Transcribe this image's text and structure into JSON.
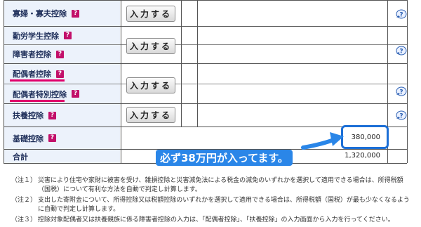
{
  "rows": [
    {
      "label": "寡婦・寡夫控除",
      "button": "入力する"
    },
    {
      "label": "勤労学生控除",
      "button": "入力する"
    },
    {
      "label": "障害者控除"
    },
    {
      "label": "配偶者控除",
      "button": "入力する"
    },
    {
      "label": "配偶者特別控除"
    },
    {
      "label": "扶養控除",
      "button": "入力する"
    },
    {
      "label": "基礎控除",
      "amount": "380,000"
    },
    {
      "label": "合計",
      "amount": "1,320,000"
    }
  ],
  "help_icon_label": "?",
  "callout": "必ず38万円が入ってます。",
  "notes": [
    {
      "num": "（注１）",
      "text": "災害により住宅や家財に被害を受け、雑損控除と災害減免法による税金の減免のいずれかを選択して適用できる場合は、所得税額（国税）について有利な方法を自動で判定し計算します。"
    },
    {
      "num": "（注２）",
      "text": "支出した寄附金について、所得控除又は税額控除のいずれかを選択して適用できる場合は、所得税額（国税）が最も少なくなるように自動で判定し計算します。"
    },
    {
      "num": "（注３）",
      "text": "控除対象配偶者又は扶養親族に係る障害者控除の入力は、「配偶者控除」、「扶養控除」の入力画面から入力を行ってください。"
    }
  ],
  "colors": {
    "accent": "#2a86e8",
    "marker": "#e0006a",
    "label_bg": "#ecf2fb"
  }
}
